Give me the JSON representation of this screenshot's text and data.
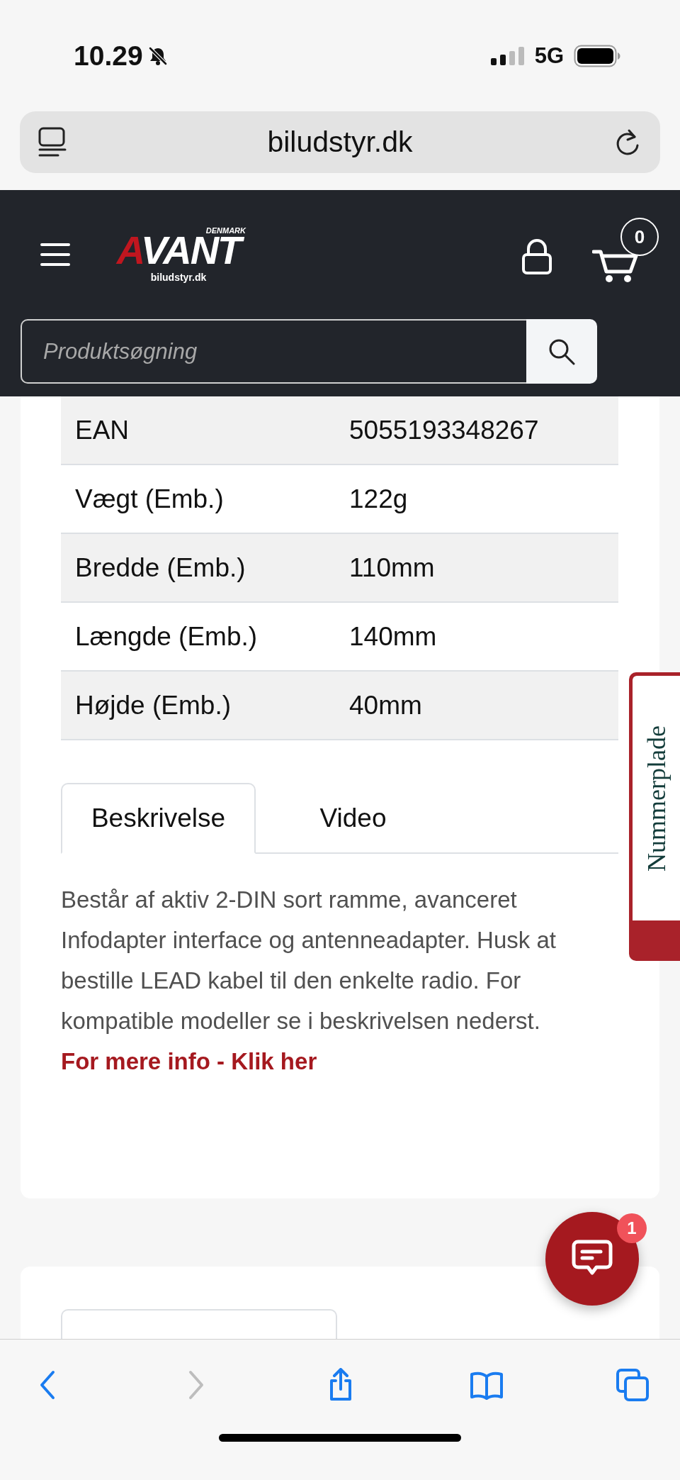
{
  "status_bar": {
    "time": "10.29",
    "silent": true,
    "network": "5G"
  },
  "address_bar": {
    "url": "biludstyr.dk"
  },
  "header": {
    "logo": {
      "wordmark": "AVANT",
      "country": "DENMARK",
      "domain": "biludstyr.dk"
    },
    "cart_count": "0"
  },
  "search": {
    "placeholder": "Produktsøgning"
  },
  "spec_table": {
    "rows": [
      {
        "label": "EAN",
        "value": "5055193348267"
      },
      {
        "label": "Vægt (Emb.)",
        "value": "122g"
      },
      {
        "label": "Bredde (Emb.)",
        "value": "110mm"
      },
      {
        "label": "Længde (Emb.)",
        "value": "140mm"
      },
      {
        "label": "Højde (Emb.)",
        "value": "40mm"
      }
    ]
  },
  "description_tabs": [
    {
      "label": "Beskrivelse",
      "selected": true
    },
    {
      "label": "Video",
      "selected": false
    }
  ],
  "description": {
    "text": "Består af aktiv 2-DIN sort ramme, avanceret Infodapter interface og antenneadapter. Husk at bestille LEAD kabel til den enkelte radio. For kompatible modeller se i beskrivelsen nederst.",
    "link": "For mere info - Klik her"
  },
  "side_tab": {
    "label": "Nummerplade"
  },
  "chat": {
    "badge": "1"
  },
  "extra_tabs": [
    {
      "selected": true
    }
  ],
  "toolbar": {
    "items": [
      {
        "kind": "back",
        "disabled": false
      },
      {
        "kind": "forward",
        "disabled": true
      },
      {
        "kind": "share",
        "disabled": false
      },
      {
        "kind": "bookmarks",
        "disabled": false
      },
      {
        "kind": "tabs",
        "disabled": false
      }
    ]
  }
}
